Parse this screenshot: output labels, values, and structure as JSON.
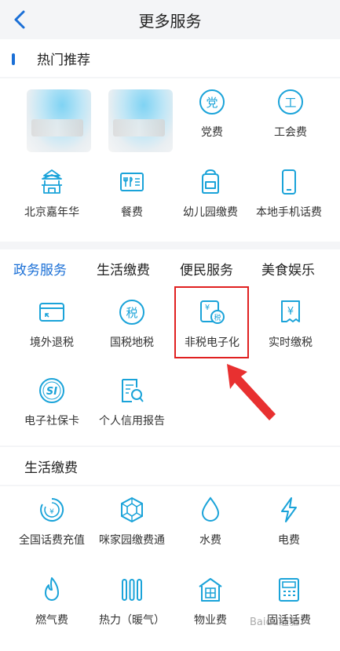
{
  "header": {
    "title": "更多服务"
  },
  "hot": {
    "title": "热门推荐",
    "items": [
      {
        "label": "党费",
        "icon": "party-fee-icon"
      },
      {
        "label": "工会费",
        "icon": "union-fee-icon"
      },
      {
        "label": "北京嘉年华",
        "icon": "temple-icon"
      },
      {
        "label": "餐费",
        "icon": "meal-icon"
      },
      {
        "label": "幼儿园缴费",
        "icon": "backpack-icon"
      },
      {
        "label": "本地手机话费",
        "icon": "mobile-phone-icon"
      }
    ]
  },
  "tabs": [
    "政务服务",
    "生活缴费",
    "便民服务",
    "美食娱乐"
  ],
  "gov": {
    "items": [
      {
        "label": "境外退税",
        "icon": "card-icon"
      },
      {
        "label": "国税地税",
        "icon": "tax-circle-icon"
      },
      {
        "label": "非税电子化",
        "icon": "non-tax-icon"
      },
      {
        "label": "实时缴税",
        "icon": "realtime-tax-icon"
      },
      {
        "label": "电子社保卡",
        "icon": "social-security-icon"
      },
      {
        "label": "个人信用报告",
        "icon": "credit-report-icon"
      }
    ]
  },
  "life": {
    "title": "生活缴费",
    "items": [
      {
        "label": "全国话费充值",
        "icon": "phone-topup-icon"
      },
      {
        "label": "咪家园缴费通",
        "icon": "hexagon-icon"
      },
      {
        "label": "水费",
        "icon": "water-drop-icon"
      },
      {
        "label": "电费",
        "icon": "lightning-icon"
      },
      {
        "label": "燃气费",
        "icon": "flame-icon"
      },
      {
        "label": "热力（暖气）",
        "icon": "radiator-icon"
      },
      {
        "label": "物业费",
        "icon": "building-icon"
      },
      {
        "label": "固话话费",
        "icon": "landline-icon"
      }
    ]
  },
  "watermark": "Baidu经验",
  "colors": {
    "accent": "#1a6fd6",
    "icon": "#1aa3d9",
    "highlight": "#e02020"
  }
}
